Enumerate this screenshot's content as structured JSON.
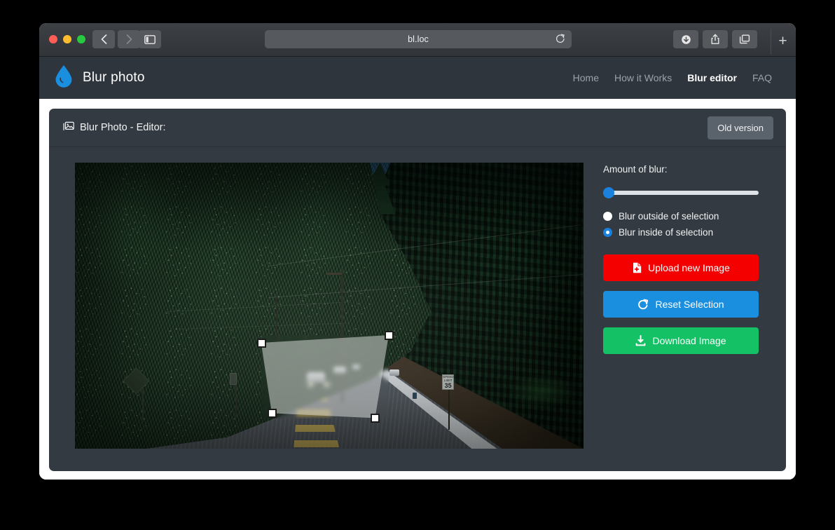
{
  "browser": {
    "url": "bl.loc",
    "traffic_lights": [
      "close",
      "minimize",
      "maximize"
    ],
    "back_icon": "chevron-left-icon",
    "forward_icon": "chevron-right-icon",
    "sidebar_icon": "sidebar-toggle-icon",
    "reload_icon": "reload-icon",
    "downloads_icon": "downloads-icon",
    "share_icon": "share-icon",
    "tabs_icon": "tab-overview-icon",
    "new_tab_label": "+"
  },
  "site": {
    "logo_icon": "water-drop-icon",
    "brand": "Blur photo",
    "nav": [
      {
        "label": "Home",
        "active": false
      },
      {
        "label": "How it Works",
        "active": false
      },
      {
        "label": "Blur editor",
        "active": true
      },
      {
        "label": "FAQ",
        "active": false
      }
    ]
  },
  "editor": {
    "title_icon": "photos-icon",
    "title": "Blur Photo - Editor:",
    "old_version_label": "Old version",
    "controls": {
      "blur_amount_label": "Amount of blur:",
      "blur_amount_value": 0,
      "blur_amount_min": 0,
      "blur_amount_max": 100,
      "radio_outside_label": "Blur outside of selection",
      "radio_inside_label": "Blur inside of selection",
      "selected_mode": "inside",
      "upload_label": "Upload new Image",
      "upload_icon": "file-upload-icon",
      "upload_color": "#f50000",
      "reset_label": "Reset Selection",
      "reset_icon": "redo-icon",
      "reset_color": "#1a8fe0",
      "download_label": "Download Image",
      "download_icon": "download-icon",
      "download_color": "#14c164"
    },
    "photo": {
      "description": "Forest road photograph with dark evergreen trees, blue mountain ridge and wet asphalt highway",
      "speed_limit_sign_top": "SPEED",
      "speed_limit_sign_mid": "LIMIT",
      "speed_limit_sign_value": "35",
      "selection_handles": [
        "top-left",
        "top-right",
        "bottom-right",
        "bottom-left"
      ]
    }
  },
  "colors": {
    "accent_blue": "#1a82dc",
    "header_bg": "#2f353d",
    "card_bg": "#343a41",
    "page_bg": "#ffffff"
  }
}
